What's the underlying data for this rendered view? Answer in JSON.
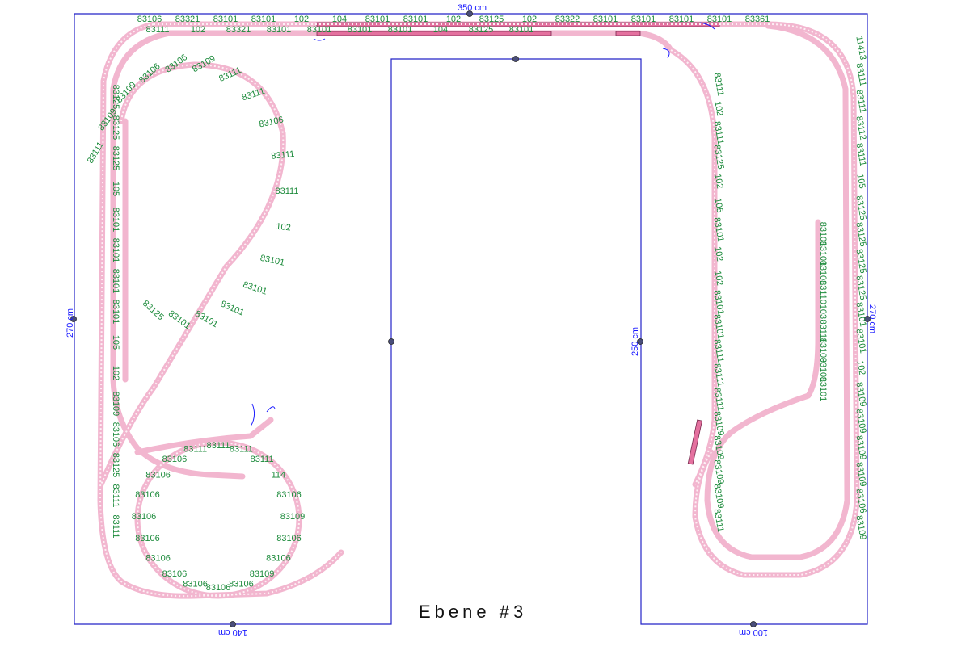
{
  "layout": {
    "title": "Ebene #3",
    "dimensions": {
      "top": "350 cm",
      "left": "270 cm",
      "right": "270 cm",
      "inner": "250 cm",
      "bottom_left": "140 cm",
      "bottom_right": "100 cm"
    }
  },
  "colors": {
    "board_outline": "#2323c8",
    "track": "#f2b6cf",
    "label": "#1b8a3a",
    "station": "#e4719f"
  },
  "labels": {
    "top_row": [
      "83106",
      "83321",
      "83101",
      "83101",
      "102",
      "104",
      "83101",
      "83101",
      "102",
      "83125",
      "102",
      "83322",
      "83101",
      "83101",
      "83101",
      "83101",
      "83361"
    ],
    "top_second_row": [
      "83111",
      "102",
      "83321",
      "83101",
      "83101",
      "83101",
      "83101",
      "104",
      "83125",
      "83101"
    ],
    "left_loop": [
      "83111",
      "83109",
      "83109",
      "83106",
      "83106",
      "83109",
      "83111",
      "83111",
      "83106",
      "83111",
      "83111",
      "102",
      "83101",
      "83101",
      "83101",
      "83101",
      "83101",
      "83125"
    ],
    "left_column": [
      "83125",
      "83125",
      "83125",
      "105",
      "83101",
      "83101",
      "83101",
      "83101",
      "105",
      "102",
      "83109",
      "83106",
      "83125",
      "83111",
      "83111"
    ],
    "left_circle": [
      "83109",
      "83106",
      "83106",
      "83109",
      "83106",
      "83106",
      "83106",
      "83106",
      "83106",
      "83106",
      "83106",
      "83106",
      "83106",
      "83106",
      "83111",
      "83111",
      "83111",
      "83111",
      "114",
      "83106"
    ],
    "right_outer": [
      "11413",
      "83111",
      "83111",
      "83112",
      "83111",
      "105",
      "83125",
      "83125",
      "83125",
      "83125",
      "83101",
      "83101",
      "102",
      "83109",
      "83109",
      "83109",
      "83109",
      "83106",
      "83109"
    ],
    "right_inner": [
      "83111",
      "102",
      "83111",
      "83125",
      "102",
      "105",
      "83101",
      "102",
      "102",
      "83101",
      "83101",
      "83111",
      "83111",
      "83111",
      "83109",
      "83109",
      "83109",
      "83109",
      "83111"
    ],
    "right_spur": [
      "83101",
      "83101",
      "83101",
      "83110",
      "103",
      "83111",
      "83109",
      "83101",
      "83101"
    ]
  }
}
